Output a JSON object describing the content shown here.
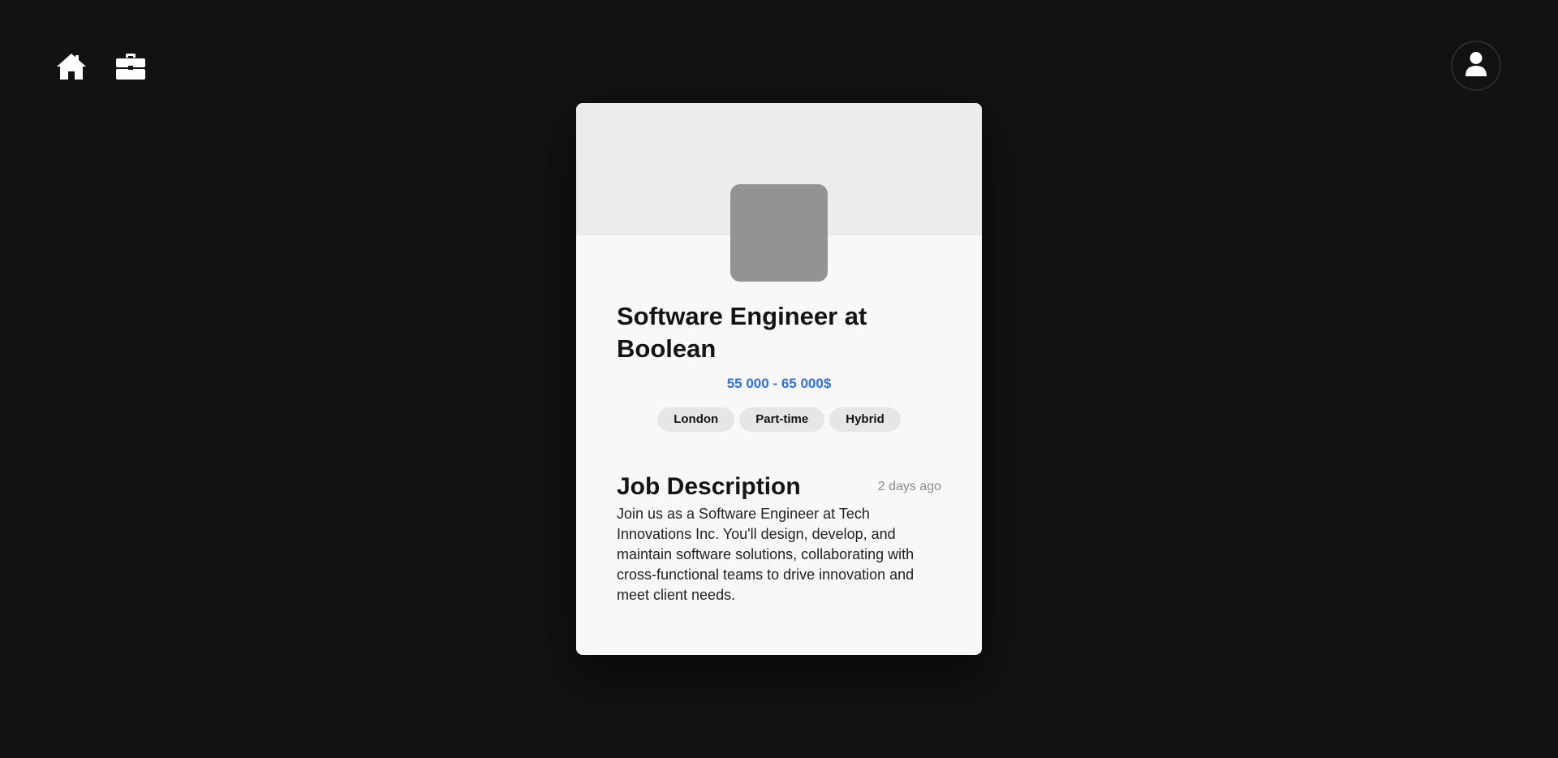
{
  "nav": {
    "home_icon": "home-icon",
    "jobs_icon": "briefcase-icon",
    "profile_icon": "user-icon"
  },
  "job": {
    "title": "Software Engineer at Boolean",
    "salary": "55 000 - 65 000$",
    "tags": [
      "London",
      "Part-time",
      "Hybrid"
    ],
    "description_heading": "Job Description",
    "posted": "2 days ago",
    "description": "Join us as a Software Engineer at Tech Innovations Inc. You'll design, develop, and maintain software solutions, collaborating with cross-functional teams to drive innovation and meet client needs."
  },
  "colors": {
    "background": "#121212",
    "card": "#f8f8f8",
    "banner": "#ececec",
    "logo_placeholder": "#939393",
    "salary_accent": "#2f6fe8"
  }
}
